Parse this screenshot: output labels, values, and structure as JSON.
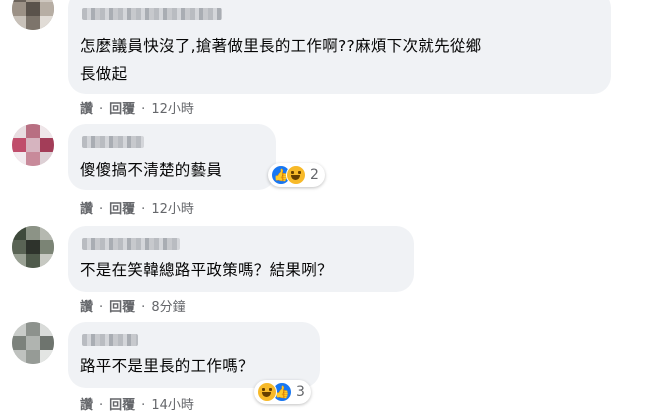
{
  "comments": [
    {
      "text_lines": [
        "怎麼議員快沒了,搶著做里長的工作啊??麻煩下次就先從鄉",
        "長做起"
      ],
      "actions": {
        "like": "讚",
        "reply": "回覆",
        "time": "12小時"
      },
      "reactions": null
    },
    {
      "text_lines": [
        "傻傻搞不清楚的藝員"
      ],
      "actions": {
        "like": "讚",
        "reply": "回覆",
        "time": "12小時"
      },
      "reactions": {
        "icons": [
          "like-icon",
          "haha-icon"
        ],
        "count": "2"
      }
    },
    {
      "text_lines": [
        "不是在笑韓總路平政策嗎？結果咧？"
      ],
      "actions": {
        "like": "讚",
        "reply": "回覆",
        "time": "8分鐘"
      },
      "reactions": null
    },
    {
      "text_lines": [
        "路平不是里長的工作嗎？"
      ],
      "actions": {
        "like": "讚",
        "reply": "回覆",
        "time": "14小時"
      },
      "reactions": {
        "icons": [
          "haha-icon",
          "like-icon"
        ],
        "count": "3"
      }
    }
  ],
  "separator": "·",
  "colors": {
    "bubble": "#f0f2f5",
    "meta": "#65676b",
    "like": "#1877f2",
    "haha": "#f7b928"
  }
}
